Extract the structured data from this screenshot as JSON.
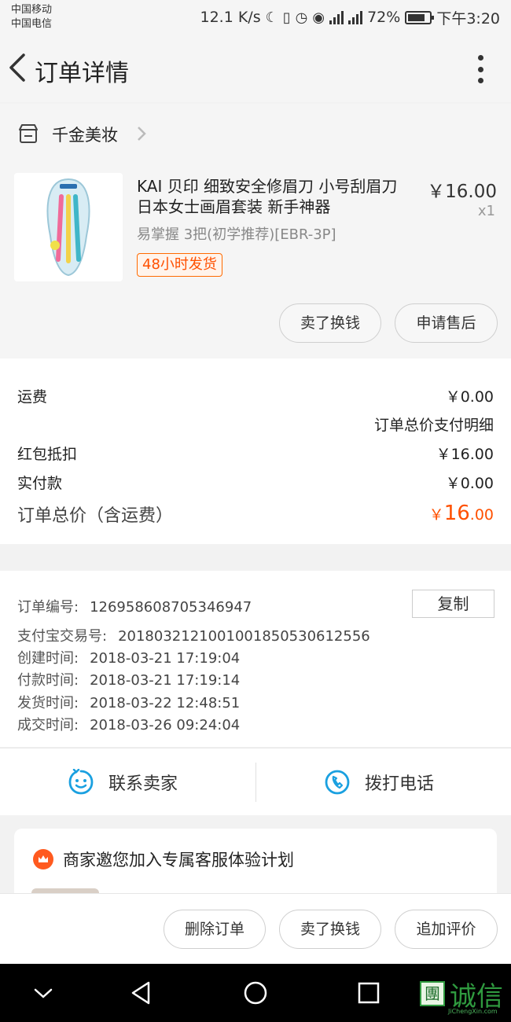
{
  "status_bar": {
    "carrier_1": "中国移动",
    "carrier_2": "中国电信",
    "net_speed": "12.1 K/s",
    "battery": "72%",
    "time": "下午3:20",
    "icons": [
      "moon-icon",
      "vibrate-icon",
      "alarm-icon",
      "eye-icon",
      "signal-2g-icon",
      "signal-4g-icon",
      "battery-icon"
    ]
  },
  "header": {
    "title": "订单详情"
  },
  "shop": {
    "name": "千金美妆"
  },
  "item": {
    "title_line1": "KAI 贝印 细致安全修眉刀 小号刮眉刀",
    "title_line2": "日本女士画眉套装 新手神器",
    "sku": "易掌握 3把(初学推荐)[EBR-3P]",
    "tag": "48小时发货",
    "price": "￥16.00",
    "qty": "x1",
    "btn_sell": "卖了换钱",
    "btn_aftersale": "申请售后"
  },
  "fees": {
    "shipping_label": "运费",
    "shipping_value": "￥0.00",
    "detail_link": "订单总价支付明细",
    "redpacket_label": "红包抵扣",
    "redpacket_value": "￥16.00",
    "paid_label": "实付款",
    "paid_value": "￥0.00",
    "total_label": "订单总价（含运费）",
    "total_currency": "￥",
    "total_int": "16",
    "total_dec": ".00"
  },
  "order_info": {
    "order_no_label": "订单编号:",
    "order_no": "126958608705346947",
    "copy": "复制",
    "alipay_label": "支付宝交易号:",
    "alipay_no": "2018032121001001850530612556",
    "created_label": "创建时间:",
    "created": "2018-03-21 17:19:04",
    "paid_label": "付款时间:",
    "paid": "2018-03-21 17:19:14",
    "shipped_label": "发货时间:",
    "shipped": "2018-03-22 12:48:51",
    "done_label": "成交时间:",
    "done": "2018-03-26 09:24:04"
  },
  "contact": {
    "seller": "联系卖家",
    "call": "拨打电话"
  },
  "invite": {
    "text": "商家邀您加入专属客服体验计划"
  },
  "actions": {
    "delete": "删除订单",
    "sell": "卖了换钱",
    "review": "追加评价"
  },
  "watermark": {
    "box": "團",
    "text": "诚信",
    "url": "JiChengXin.com"
  },
  "colors": {
    "accent": "#ff5000",
    "blue_icon": "#1aa0e0",
    "watermark_green": "#2f9a3f"
  }
}
